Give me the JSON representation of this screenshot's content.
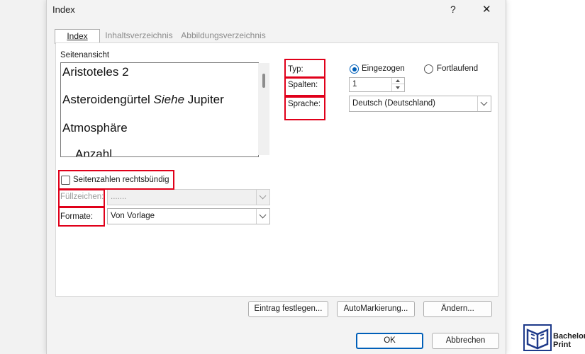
{
  "window": {
    "title": "Index",
    "help_glyph": "?",
    "close_glyph": "✕"
  },
  "tabs": [
    {
      "label": "Index",
      "active": true
    },
    {
      "label": "Inhaltsverzeichnis",
      "active": false
    },
    {
      "label": "Abbildungsverzeichnis",
      "active": false
    }
  ],
  "preview": {
    "label": "Seitenansicht",
    "lines": [
      "Aristoteles  2",
      "Asteroidengürtel",
      "Siehe",
      "Jupiter",
      "Atmosphäre",
      "Anzahl"
    ]
  },
  "typ": {
    "label": "Typ:",
    "options": [
      "Eingezogen",
      "Fortlaufend"
    ],
    "selected": "Eingezogen"
  },
  "spalten": {
    "label": "Spalten:",
    "value": "1"
  },
  "sprache": {
    "label": "Sprache:",
    "value": "Deutsch (Deutschland)"
  },
  "seitenzahlen": {
    "label": "Seitenzahlen rechtsbündig",
    "checked": false
  },
  "fuellzeichen": {
    "label": "Füllzeichen:",
    "value": "......."
  },
  "formate": {
    "label": "Formate:",
    "value": "Von Vorlage"
  },
  "buttons": {
    "eintrag": "Eintrag festlegen...",
    "automarkierung": "AutoMarkierung...",
    "aendern": "Ändern...",
    "ok": "OK",
    "abbrechen": "Abbrechen"
  },
  "branding": {
    "line1": "Bachelor",
    "line2": "Print"
  },
  "colors": {
    "highlight": "#e0001a",
    "accent": "#005fb8",
    "brand": "#1e3a8a"
  }
}
